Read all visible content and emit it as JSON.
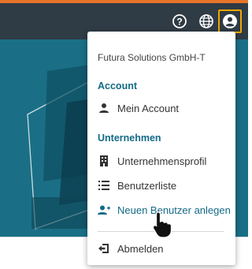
{
  "accent_color": "#e8742a",
  "topbar": {
    "icons": [
      "help-icon",
      "globe-icon",
      "account-circle-icon"
    ]
  },
  "menu": {
    "organization": "Futura Solutions GmbH-T",
    "account_section": "Account",
    "my_account": "Mein Account",
    "company_section": "Unternehmen",
    "company_profile": "Unternehmensprofil",
    "user_list": "Benutzerliste",
    "new_user": "Neuen Benutzer anlegen",
    "logout": "Abmelden"
  },
  "colors": {
    "topbar": "#2f3b45",
    "hero": "#1a6f86",
    "link": "#136a86",
    "highlight_border": "#f0a500"
  }
}
